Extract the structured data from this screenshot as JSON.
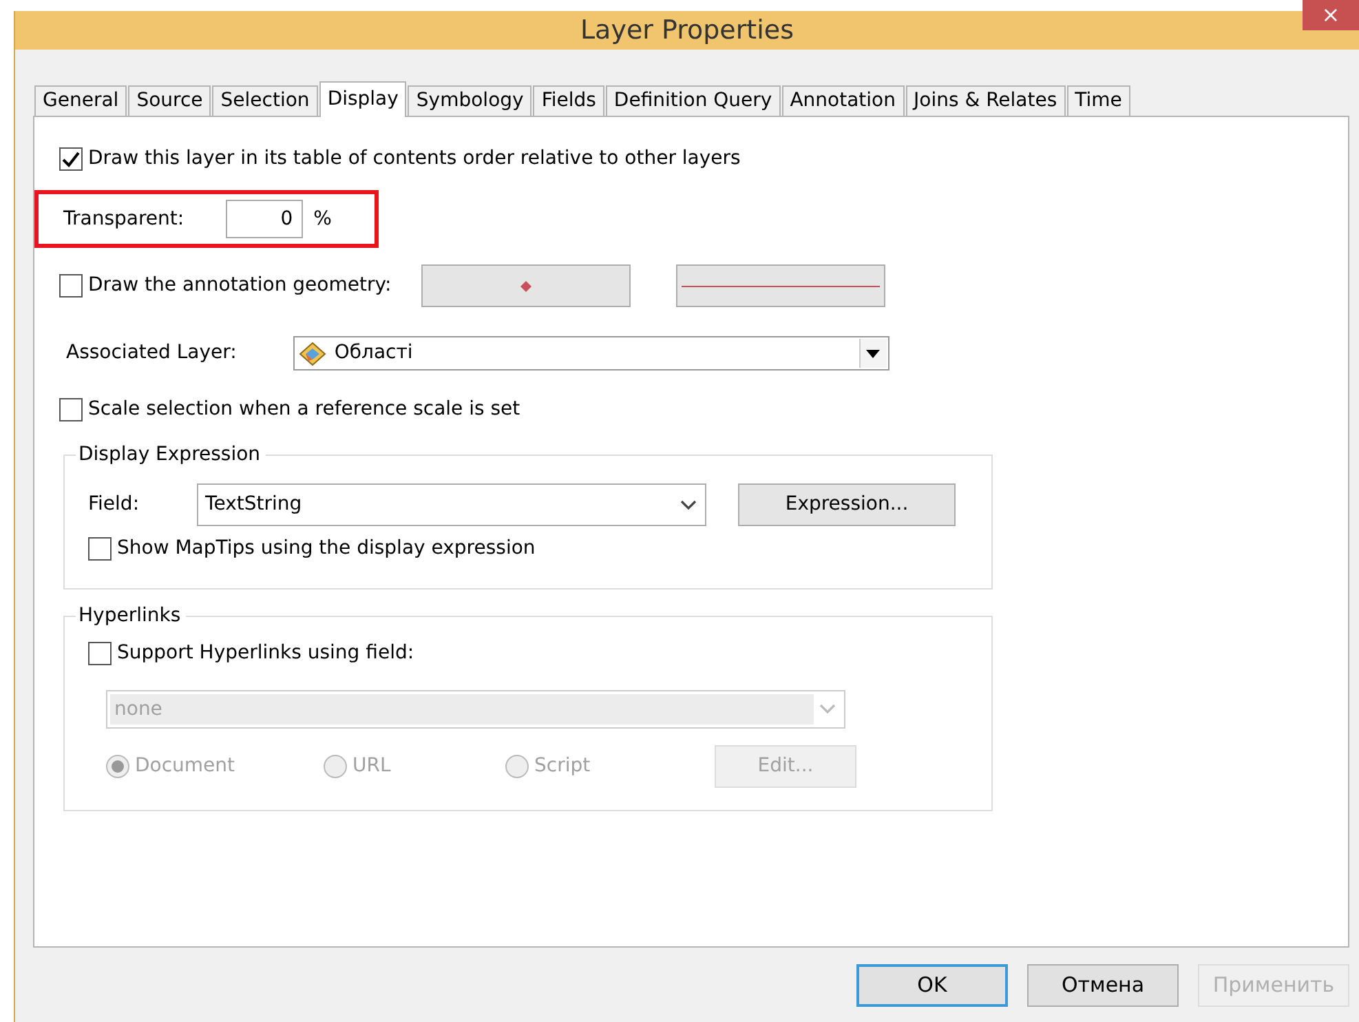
{
  "window": {
    "title": "Layer Properties",
    "close": "×"
  },
  "tabs": [
    {
      "label": "General",
      "selected": false
    },
    {
      "label": "Source",
      "selected": false
    },
    {
      "label": "Selection",
      "selected": false
    },
    {
      "label": "Display",
      "selected": true
    },
    {
      "label": "Symbology",
      "selected": false
    },
    {
      "label": "Fields",
      "selected": false
    },
    {
      "label": "Definition Query",
      "selected": false
    },
    {
      "label": "Annotation",
      "selected": false
    },
    {
      "label": "Joins & Relates",
      "selected": false
    },
    {
      "label": "Time",
      "selected": false
    }
  ],
  "draw_order": {
    "label": "Draw this layer in its table of contents order relative to other layers",
    "checked": true
  },
  "transparent": {
    "label": "Transparent:",
    "value": "0",
    "unit": "%",
    "highlighted": true
  },
  "annotation_geometry": {
    "label": "Draw the annotation geometry:",
    "checked": false
  },
  "associated_layer": {
    "label": "Associated Layer:",
    "value": "Області"
  },
  "scale_selection": {
    "label": "Scale selection when a reference scale is set",
    "checked": false
  },
  "display_expression": {
    "title": "Display Expression",
    "field_label": "Field:",
    "field_value": "TextString",
    "expression_button": "Expression...",
    "maptips": {
      "label": "Show MapTips using the display expression",
      "checked": false
    }
  },
  "hyperlinks": {
    "title": "Hyperlinks",
    "support": {
      "label": "Support Hyperlinks using field:",
      "checked": false
    },
    "field_value": "none",
    "disabled": true,
    "options": [
      {
        "label": "Document",
        "selected": true
      },
      {
        "label": "URL",
        "selected": false
      },
      {
        "label": "Script",
        "selected": false
      }
    ],
    "edit_button": "Edit..."
  },
  "buttons": [
    {
      "label": "OK",
      "kind": "default",
      "disabled": false
    },
    {
      "label": "Отмена",
      "kind": "normal",
      "disabled": false
    },
    {
      "label": "Применить",
      "kind": "normal",
      "disabled": true
    }
  ]
}
